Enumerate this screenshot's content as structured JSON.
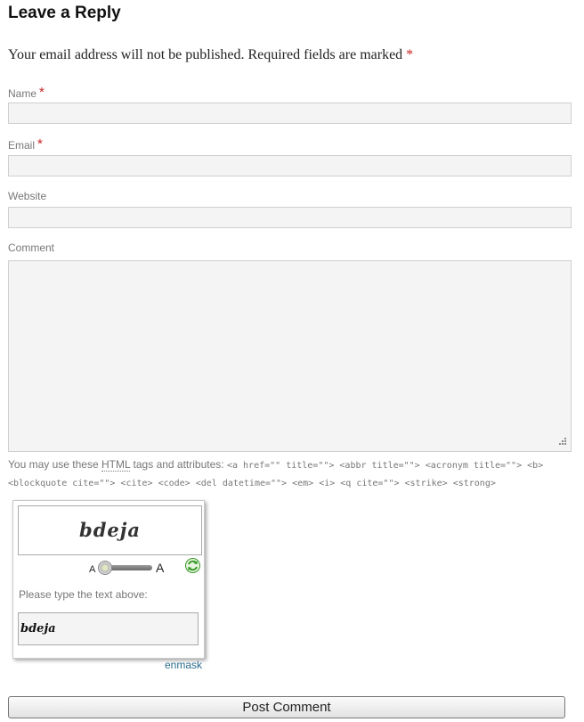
{
  "reply": {
    "title": "Leave a Reply",
    "notes": "Your email address will not be published. Required fields are marked",
    "required_mark": "*"
  },
  "fields": {
    "name": {
      "label": "Name",
      "value": "",
      "required": true
    },
    "email": {
      "label": "Email",
      "value": "",
      "required": true
    },
    "website": {
      "label": "Website",
      "value": "",
      "required": false
    },
    "comment": {
      "label": "Comment",
      "value": ""
    }
  },
  "allowed_tags": {
    "prefix": "You may use these",
    "html_abbr": "HTML",
    "suffix": "tags and attributes:",
    "tags": "<a href=\"\" title=\"\"> <abbr title=\"\"> <acronym title=\"\"> <b> <blockquote cite=\"\"> <cite> <code> <del datetime=\"\"> <em> <i> <q cite=\"\"> <strike> <strong>"
  },
  "captcha": {
    "image_text": "bdeja",
    "zoom_small": "A",
    "zoom_large": "A",
    "zoom_level": 0.1,
    "refresh_icon": "refresh-icon",
    "prompt": "Please type the text above:",
    "input_value": "bdeja",
    "brand_link": "enmask",
    "link_color": "#2a6d8f"
  },
  "submit": {
    "label": "Post Comment"
  },
  "colors": {
    "required": "#cc2222",
    "refresh_green": "#3a9a2a"
  }
}
